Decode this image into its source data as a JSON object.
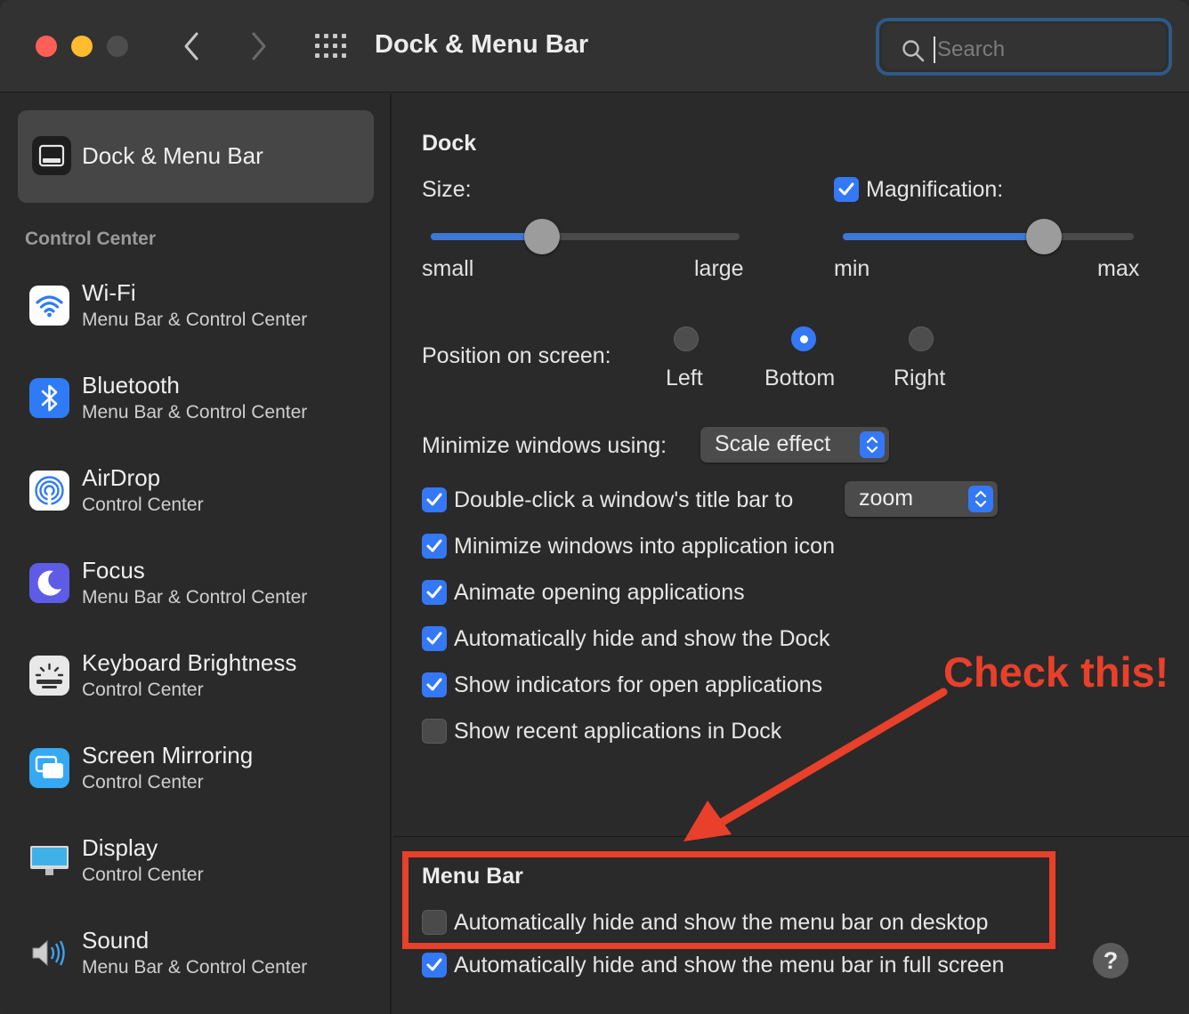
{
  "window": {
    "title": "Dock & Menu Bar",
    "search_placeholder": "Search"
  },
  "sidebar": {
    "selected": {
      "label": "Dock & Menu Bar",
      "icon": "dock-menubar-icon"
    },
    "section_header": "Control Center",
    "items": [
      {
        "title": "Wi-Fi",
        "subtitle": "Menu Bar & Control Center",
        "icon": "wifi-icon"
      },
      {
        "title": "Bluetooth",
        "subtitle": "Menu Bar & Control Center",
        "icon": "bluetooth-icon"
      },
      {
        "title": "AirDrop",
        "subtitle": "Control Center",
        "icon": "airdrop-icon"
      },
      {
        "title": "Focus",
        "subtitle": "Menu Bar & Control Center",
        "icon": "moon-icon"
      },
      {
        "title": "Keyboard Brightness",
        "subtitle": "Control Center",
        "icon": "keyboard-brightness-icon"
      },
      {
        "title": "Screen Mirroring",
        "subtitle": "Control Center",
        "icon": "screen-mirroring-icon"
      },
      {
        "title": "Display",
        "subtitle": "Control Center",
        "icon": "display-icon"
      },
      {
        "title": "Sound",
        "subtitle": "Menu Bar & Control Center",
        "icon": "speaker-icon"
      }
    ]
  },
  "dock": {
    "heading": "Dock",
    "size": {
      "label": "Size:",
      "min_label": "small",
      "max_label": "large",
      "value": 0.36
    },
    "magnification": {
      "label": "Magnification:",
      "checked": true,
      "min_label": "min",
      "max_label": "max",
      "value": 0.69
    },
    "position": {
      "label": "Position on screen:",
      "options": [
        "Left",
        "Bottom",
        "Right"
      ],
      "selected": "Bottom"
    },
    "minimize": {
      "label": "Minimize windows using:",
      "value": "Scale effect"
    },
    "double_click": {
      "label": "Double-click a window's title bar to",
      "value": "zoom",
      "checked": true
    },
    "options": [
      {
        "label": "Minimize windows into application icon",
        "checked": true
      },
      {
        "label": "Animate opening applications",
        "checked": true
      },
      {
        "label": "Automatically hide and show the Dock",
        "checked": true
      },
      {
        "label": "Show indicators for open applications",
        "checked": true
      },
      {
        "label": "Show recent applications in Dock",
        "checked": false
      }
    ]
  },
  "menu_bar": {
    "heading": "Menu Bar",
    "options": [
      {
        "label": "Automatically hide and show the menu bar on desktop",
        "checked": false
      },
      {
        "label": "Automatically hide and show the menu bar in full screen",
        "checked": true
      }
    ]
  },
  "help_label": "?",
  "annotation": {
    "text": "Check this!",
    "color": "#e8402a"
  },
  "colors": {
    "accent": "#3478f6",
    "annotation": "#e8402a"
  }
}
